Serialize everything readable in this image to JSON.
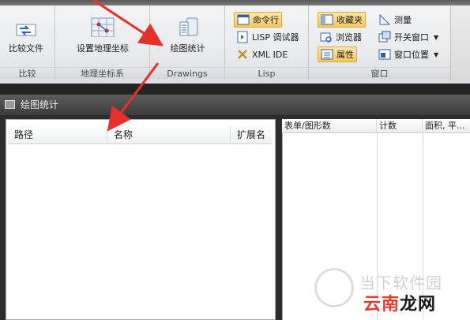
{
  "ribbon": {
    "groups": [
      {
        "label": "比较",
        "button": "比较文件"
      },
      {
        "label": "地理坐标系",
        "button": "设置地理坐标"
      },
      {
        "label": "Drawings",
        "button": "绘图统计"
      },
      {
        "label": "Lisp",
        "items": [
          "命令行",
          "LISP 调试器",
          "XML IDE"
        ]
      },
      {
        "label": "窗口",
        "items": [
          "收藏夹",
          "浏览器",
          "属性",
          "测量",
          "开关窗口",
          "窗口位置"
        ]
      }
    ]
  },
  "panel": {
    "title": "绘图统计",
    "left_columns": [
      "路径",
      "名称",
      "扩展名"
    ],
    "right_columns": [
      "表单/图形数",
      "计数",
      "面积, 平..."
    ]
  },
  "watermark": {
    "line1": "当下软件园",
    "line2_part1": "云南",
    "line2_part2": "龙网"
  },
  "colors": {
    "active_highlight": "#f8c85d",
    "arrow": "#e8302a",
    "watermark_accent": "#e23c2e"
  },
  "icons": {
    "compare": "compare-files-icon",
    "geo": "geo-coordinate-icon",
    "drawing_stats": "drawing-stats-icon",
    "command_line": "command-line-icon",
    "lisp": "lisp-debugger-icon",
    "xml": "xml-ide-icon",
    "favorites": "favorites-icon",
    "browser": "browser-icon",
    "properties": "properties-icon",
    "measure": "measure-icon",
    "toggle_window": "toggle-window-icon",
    "window_position": "window-position-icon"
  }
}
